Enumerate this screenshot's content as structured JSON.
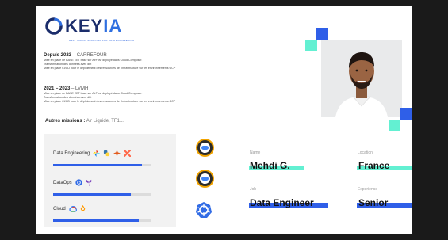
{
  "brand": {
    "name_dark": "KEY",
    "name_accent": "IA",
    "tagline": "BEST TALENT SOURCING FOR DATA ENGINEERING"
  },
  "experience": [
    {
      "header": "Depuis 2023",
      "company": " – CARREFOUR",
      "lines": [
        "Mise en place de BASE EET basé sur AirFlow déployé dans Cloud Composer.",
        "Transformation des données avec dbt",
        "Mise en place CI/CD pour le déploiement des ressources de l'infrastructure sur les environnements GCP"
      ]
    },
    {
      "header": "2021 – 2023",
      "company": " – LVMH",
      "lines": [
        "Mise en place de BASE EET basé sur AirFlow déployé dans Cloud Composer.",
        "Transformation des données avec dbt",
        "Mise en place CI/CD pour le déploiement des ressources de l'infrastructure sur les environnements GCP"
      ]
    }
  ],
  "other_missions": {
    "label": "Autres missions :",
    "value": " Air Liquide, TF1..."
  },
  "skills": [
    {
      "label": "Data Engineering",
      "level": 0.91,
      "icons": [
        "airflow-icon",
        "python-icon",
        "spark-icon",
        "dbt-icon"
      ]
    },
    {
      "label": "DataOps",
      "level": 0.8,
      "icons": [
        "kubernetes-icon",
        "terraform-icon"
      ]
    },
    {
      "label": "Cloud",
      "level": 0.88,
      "icons": [
        "gcp-icon",
        "aws-icon"
      ]
    }
  ],
  "badges": [
    "gcp-professional-badge",
    "gcp-data-engineer-badge",
    "kubernetes-badge"
  ],
  "profile": {
    "name_label": "Name",
    "name": "Mehdi G.",
    "location_label": "Location",
    "location": "France",
    "job_label": "Job",
    "job": "Data Engineer",
    "experience_label": "Experience",
    "experience": "Senior"
  },
  "colors": {
    "accent_blue": "#2f5fe8",
    "accent_teal": "#63f0d2",
    "brand_dark": "#1b2d6b"
  }
}
